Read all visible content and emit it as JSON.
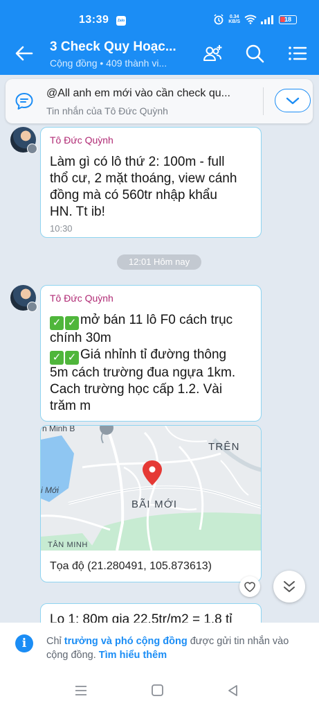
{
  "status_bar": {
    "time": "13:39",
    "app_badge": "Zalo",
    "net_speed_value": "0.34",
    "net_speed_unit": "KB/S",
    "battery": "18"
  },
  "header": {
    "title": "3 Check Quy Hoạc...",
    "subtitle": "Cộng đồng • 409 thành vi..."
  },
  "pinned": {
    "text": "@All anh em mới vào cần check qu...",
    "subtitle": "Tin nhắn của Tô Đức Quỳnh"
  },
  "messages": [
    {
      "sender": "Tô Đức Quỳnh",
      "lines": [
        "Làm gì có lô thứ 2: 100m - full",
        "thổ cư, 2 mặt thoáng, view cánh",
        "đồng mà có 560tr nhập khẩu",
        "HN. Tt ib!"
      ],
      "time": "10:30"
    },
    {
      "sender": "Tô Đức Quỳnh",
      "lines": [
        "mở bán 11 lô F0 cách trục",
        "chính 30m",
        "Giá nhỉnh tỉ đường thông",
        "5m cách trường đua ngựa 1km.",
        "Cach trường học cấp 1.2. Vài",
        "trăm m"
      ]
    }
  ],
  "date_separator": "12:01 Hôm nay",
  "map_card": {
    "labels": {
      "top_left": "h Minh B",
      "tren": "TRÊN",
      "bai_moi_left": "i Mới",
      "bai_moi": "BÃI MỚI",
      "tan_minh": "TÂN MINH"
    },
    "coordinates": "Tọa độ (21.280491, 105.873613)"
  },
  "partial_message": "Lo 1: 80m gia 22.5tr/m2 = 1.8 tỉ",
  "notice": {
    "part1": "Chỉ ",
    "highlight1": "trưởng và phó cộng đồng",
    "part2": " được gửi tin nhắn vào cộng đồng. ",
    "link": "Tìm hiểu thêm"
  },
  "colors": {
    "primary": "#1b8df5",
    "sender": "#b02a74",
    "bubble_border": "#8fd4f0",
    "check": "#4fb63b"
  }
}
